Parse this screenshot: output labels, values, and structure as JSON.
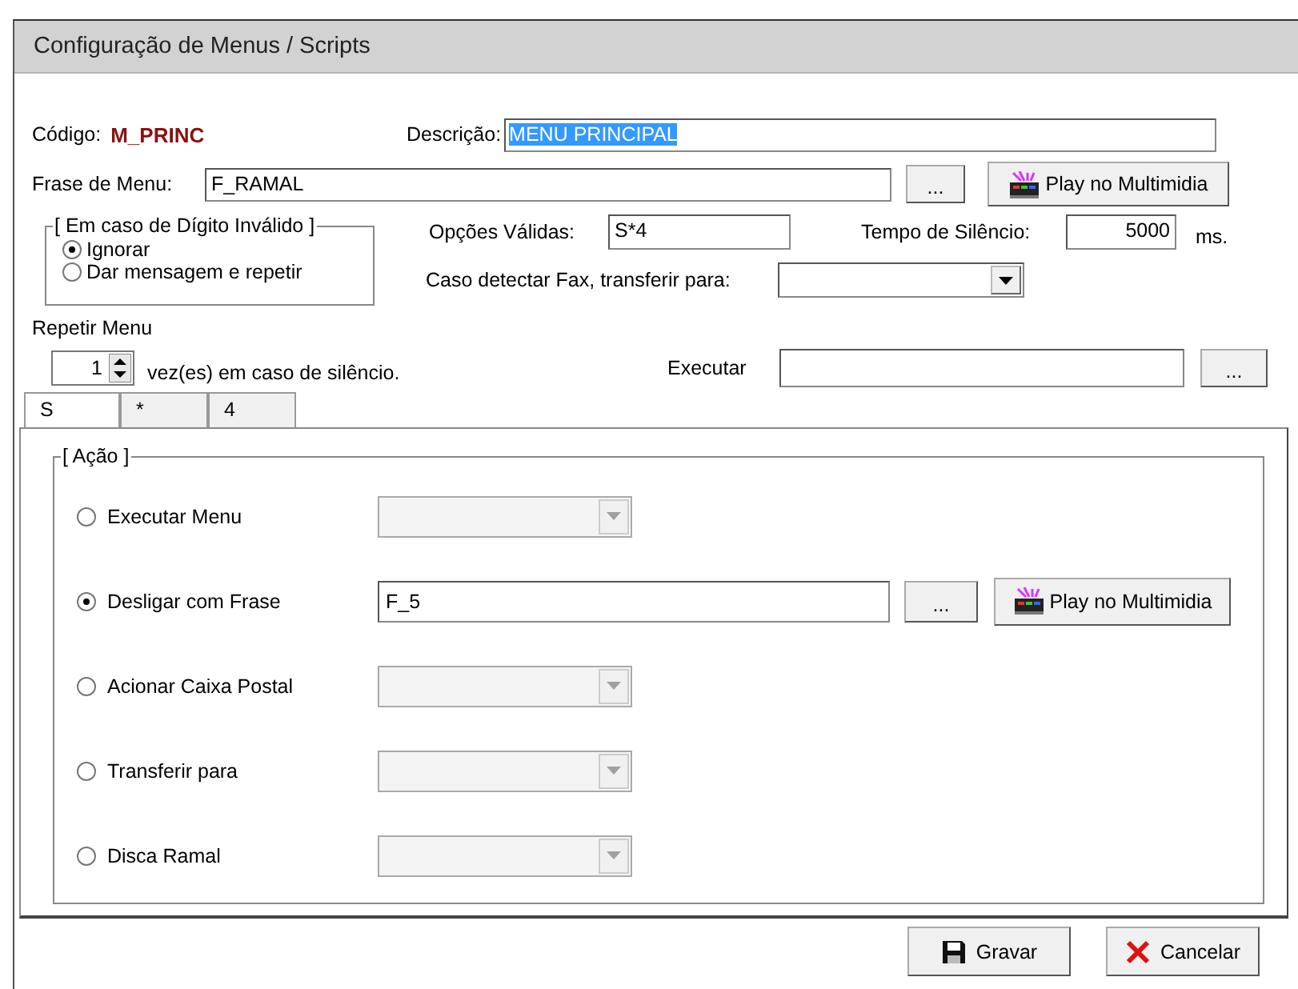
{
  "window": {
    "title": "Configuração de Menus / Scripts"
  },
  "codigo": {
    "label": "Código:",
    "value": "M_PRINC"
  },
  "descricao": {
    "label": "Descrição:",
    "value": "MENU PRINCIPAL",
    "text_selected": true
  },
  "frase_menu": {
    "label": "Frase de Menu:",
    "value": "F_RAMAL",
    "browse_button": "...",
    "play_button": "Play no Multimidia"
  },
  "invalid_digit_group": {
    "title": "[ Em caso de Dígito Inválido ]",
    "options": [
      {
        "label": "Ignorar",
        "selected": true
      },
      {
        "label": "Dar mensagem e repetir",
        "selected": false
      }
    ]
  },
  "opcoes_validas": {
    "label": "Opções Válidas:",
    "value": "S*4"
  },
  "tempo_silencio": {
    "label": "Tempo de Silêncio:",
    "value": "5000",
    "unit": "ms."
  },
  "fax_transfer": {
    "label": "Caso detectar Fax, transferir para:",
    "disabled": false
  },
  "repetir_menu": {
    "label": "Repetir Menu",
    "value": "1",
    "suffix": "vez(es) em caso de silêncio."
  },
  "executar": {
    "label": "Executar",
    "browse_button": "..."
  },
  "tabs": [
    {
      "label": "S",
      "selected": true
    },
    {
      "label": "*",
      "selected": false
    },
    {
      "label": "4",
      "selected": false
    }
  ],
  "action_group": {
    "title": "[ Ação ]",
    "actions": [
      {
        "kind": "combo",
        "label": "Executar Menu",
        "selected": false,
        "disabled": true
      },
      {
        "kind": "phrase",
        "label": "Desligar com Frase",
        "selected": true,
        "value": "F_5",
        "browse_button": "...",
        "play_button": "Play no Multimidia"
      },
      {
        "kind": "combo",
        "label": "Acionar Caixa Postal",
        "selected": false,
        "disabled": true
      },
      {
        "kind": "combo",
        "label": "Transferir para",
        "selected": false,
        "disabled": true
      },
      {
        "kind": "combo",
        "label": "Disca Ramal",
        "selected": false,
        "disabled": true
      }
    ]
  },
  "buttons": [
    {
      "kind": "save",
      "label": "Gravar"
    },
    {
      "kind": "cancel",
      "label": "Cancelar"
    }
  ]
}
